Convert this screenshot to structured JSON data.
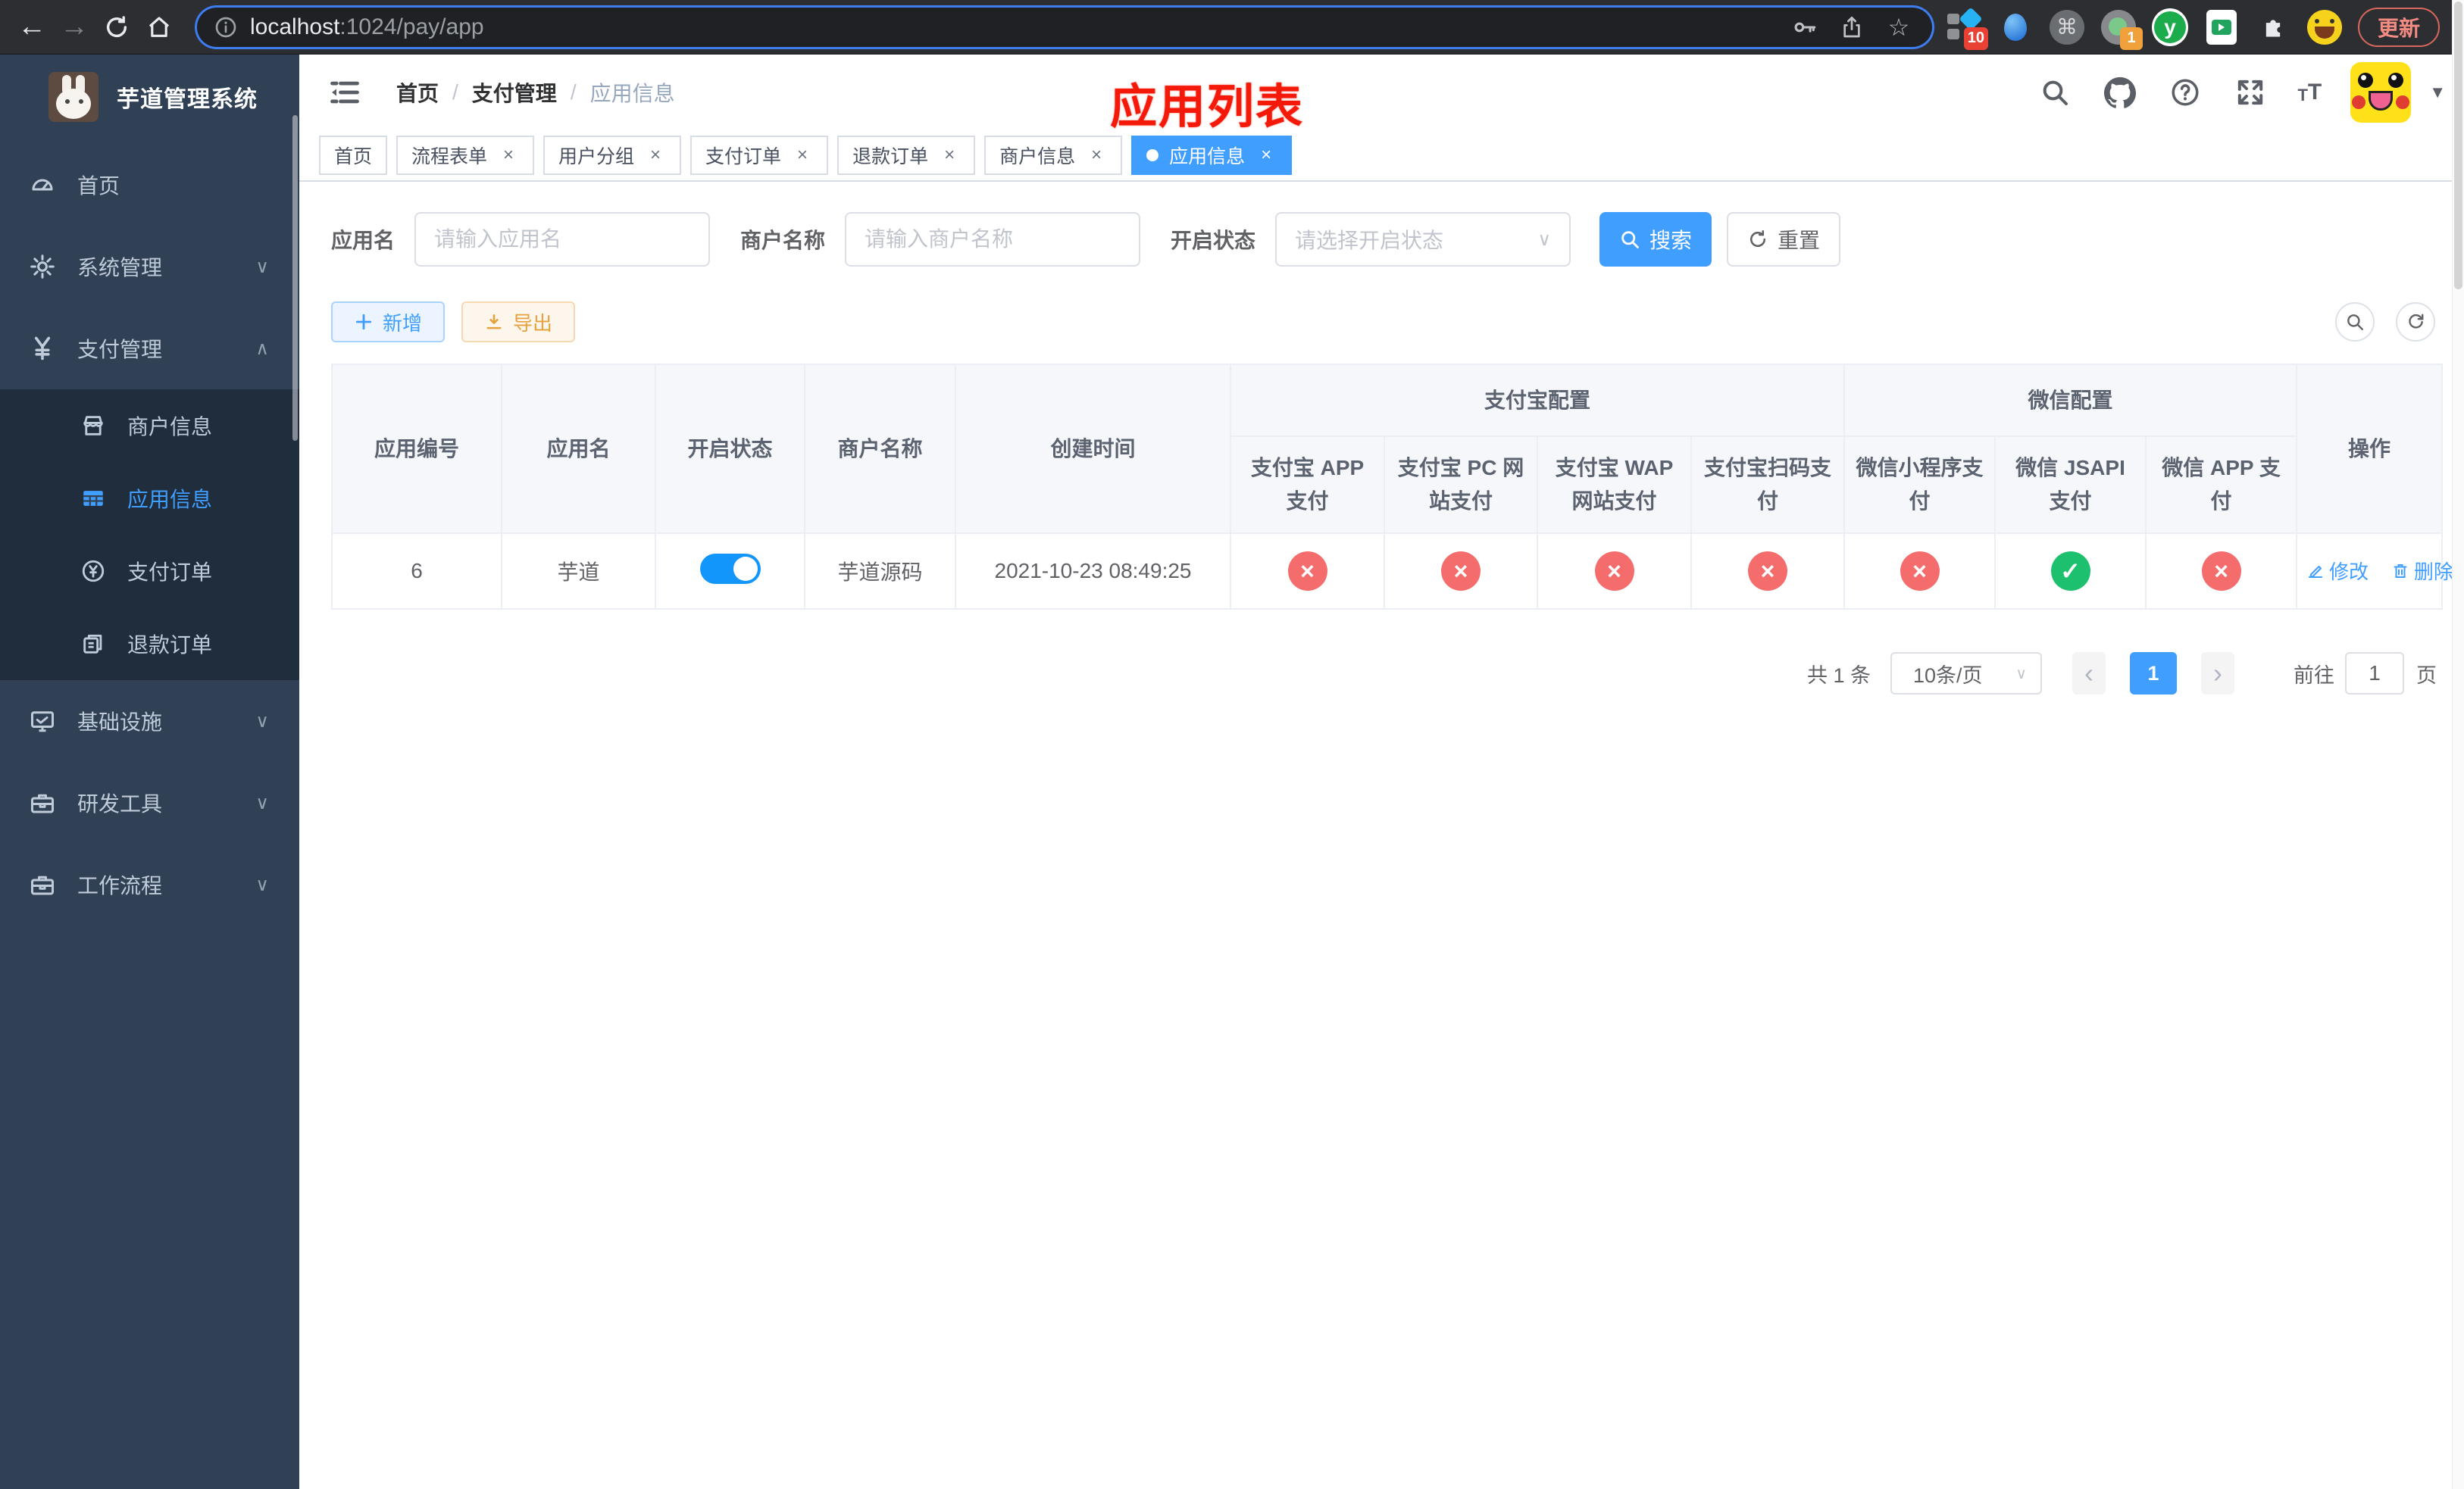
{
  "browser": {
    "url_host": "localhost",
    "url_rest": ":1024/pay/app",
    "update_label": "更新",
    "ext_badge_pin": "10",
    "ext_badge_rec": "1",
    "ext_y_monogram": "y",
    "cmd_glyph": "⌘"
  },
  "sidebar": {
    "app_title": "芋道管理系统",
    "items": [
      {
        "label": "首页"
      },
      {
        "label": "系统管理"
      },
      {
        "label": "支付管理"
      },
      {
        "label": "基础设施"
      },
      {
        "label": "研发工具"
      },
      {
        "label": "工作流程"
      }
    ],
    "payment_children": [
      {
        "label": "商户信息"
      },
      {
        "label": "应用信息"
      },
      {
        "label": "支付订单"
      },
      {
        "label": "退款订单"
      }
    ]
  },
  "header": {
    "breadcrumb": [
      "首页",
      "支付管理",
      "应用信息"
    ],
    "separator": "/",
    "overlay_title": "应用列表"
  },
  "tabs": [
    {
      "label": "首页"
    },
    {
      "label": "流程表单"
    },
    {
      "label": "用户分组"
    },
    {
      "label": "支付订单"
    },
    {
      "label": "退款订单"
    },
    {
      "label": "商户信息"
    },
    {
      "label": "应用信息"
    }
  ],
  "filters": {
    "app_name_label": "应用名",
    "app_name_placeholder": "请输入应用名",
    "merchant_label": "商户名称",
    "merchant_placeholder": "请输入商户名称",
    "status_label": "开启状态",
    "status_placeholder": "请选择开启状态",
    "search_label": "搜索",
    "reset_label": "重置"
  },
  "toolbar": {
    "add_label": "新增",
    "export_label": "导出"
  },
  "table": {
    "headers": {
      "app_id": "应用编号",
      "app_name": "应用名",
      "status": "开启状态",
      "merchant": "商户名称",
      "created": "创建时间",
      "alipay_group": "支付宝配置",
      "wechat_group": "微信配置",
      "actions": "操作",
      "alipay_cols": [
        "支付宝 APP 支付",
        "支付宝 PC 网站支付",
        "支付宝 WAP 网站支付",
        "支付宝扫码支付"
      ],
      "wechat_cols": [
        "微信小程序支付",
        "微信 JSAPI 支付",
        "微信 APP 支付"
      ]
    },
    "row": {
      "id": "6",
      "name": "芋道",
      "status_on": true,
      "merchant": "芋道源码",
      "created": "2021-10-23 08:49:25",
      "channels": [
        "x",
        "x",
        "x",
        "x",
        "x",
        "check",
        "x"
      ],
      "edit_label": "修改",
      "delete_label": "删除"
    }
  },
  "pagination": {
    "total": "共 1 条",
    "page_size": "10条/页",
    "current_page": "1",
    "goto_label": "前往",
    "goto_value": "1",
    "page_unit": "页"
  },
  "colors": {
    "primary": "#409eff",
    "danger": "#f56c6c",
    "success": "#1dc06c",
    "warning": "#e6a23c",
    "sidebar_bg": "#304156",
    "submenu_bg": "#1f2d3d",
    "title_red": "#f5190a"
  }
}
